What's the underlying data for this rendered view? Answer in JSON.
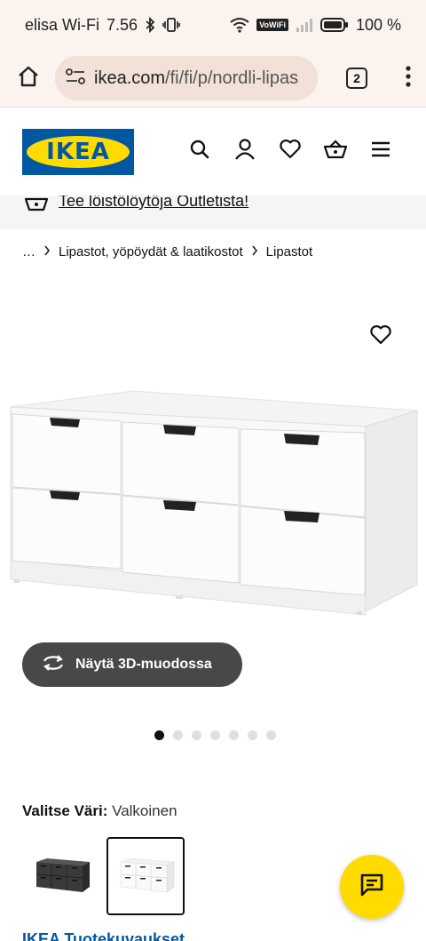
{
  "statusbar": {
    "carrier": "elisa Wi-Fi",
    "time": "7.56",
    "vowifi": "VoWiFi",
    "battery": "100 %"
  },
  "browser": {
    "url_host": "ikea.com",
    "url_path": "/fi/fi/p/nordli-lipas",
    "tab_count": "2"
  },
  "header": {
    "logo_text": "IKEA",
    "icons": [
      "search-icon",
      "account-icon",
      "heart-icon",
      "basket-icon",
      "hamburger-icon"
    ]
  },
  "outlet": {
    "text": "Tee löistölöytöja Outletista!"
  },
  "breadcrumb": {
    "ellipsis": "…",
    "items": [
      "Lipastot, yöpöydät & laatikostot",
      "Lipastot"
    ]
  },
  "gallery": {
    "view_3d_label": "Näytä 3D-muodossa",
    "dots_count": 7,
    "active_dot": 0
  },
  "color": {
    "label": "Valitse Väri:",
    "value": "Valkoinen",
    "swatches": [
      {
        "name": "black",
        "selected": false
      },
      {
        "name": "white",
        "selected": true
      }
    ]
  },
  "next_title": "IKEA Tuotekuvaukset",
  "colors": {
    "ikea_blue": "#0058a3",
    "ikea_yellow": "#ffdb00",
    "chrome_bg": "#fbf3ee"
  }
}
